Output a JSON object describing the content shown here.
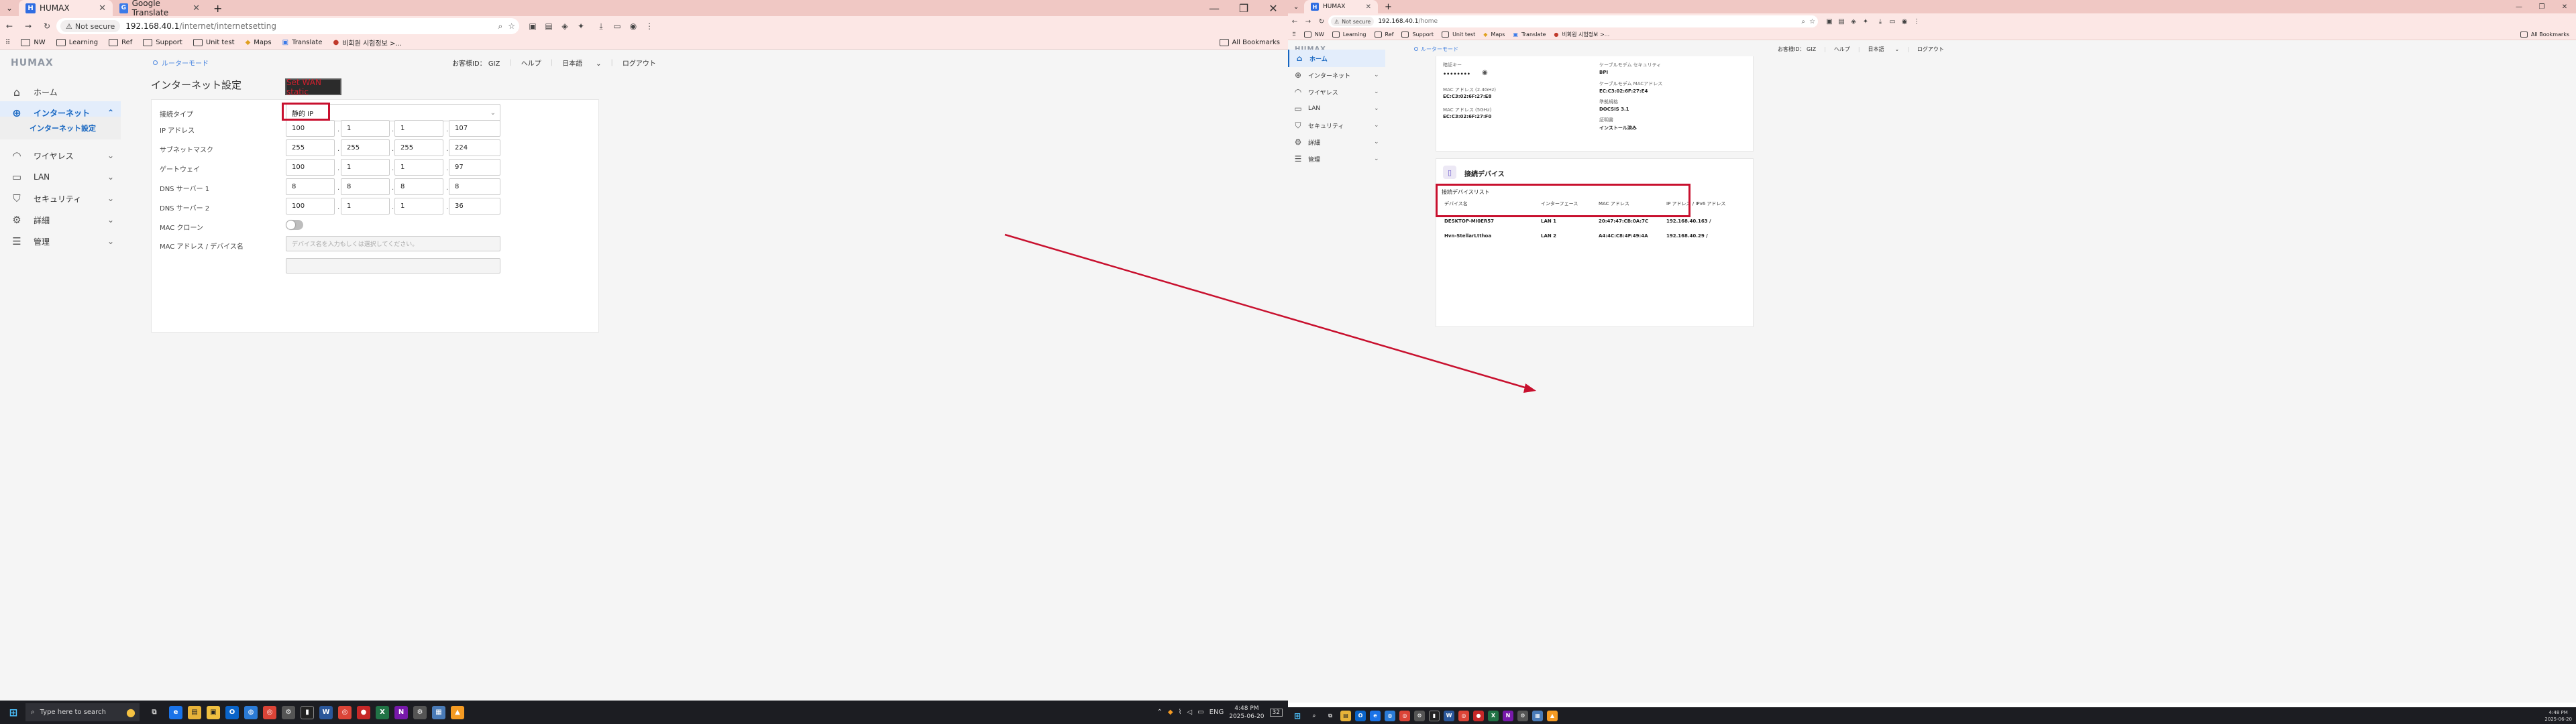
{
  "left": {
    "tabs": [
      {
        "title": "HUMAX"
      },
      {
        "title": "Google Translate"
      }
    ],
    "address": {
      "not_secure": "Not secure",
      "host": "192.168.40.1",
      "path": "/internet/internetsetting"
    },
    "bookmarks": [
      "NW",
      "Learning",
      "Ref",
      "Support",
      "Unit test",
      "Maps",
      "Translate",
      "비회원 시험정보 >..."
    ],
    "all_bookmarks": "All Bookmarks",
    "logo": "HUMAX",
    "router_mode": "ルーターモード",
    "customer_id": "お客様ID： GIZ",
    "help": "ヘルプ",
    "language": "日本語",
    "logout": "ログアウト",
    "nav": [
      {
        "label": "ホーム"
      },
      {
        "label": "インターネット"
      },
      {
        "label": "ワイヤレス"
      },
      {
        "label": "LAN"
      },
      {
        "label": "セキュリティ"
      },
      {
        "label": "詳細"
      },
      {
        "label": "管理"
      }
    ],
    "nav_sub": "インターネット設定",
    "page_title": "インターネット設定",
    "annotation_button": "Set WAN static",
    "form": {
      "connection_type_label": "接続タイプ",
      "connection_type_value": "静的 IP",
      "ip_label": "IP アドレス",
      "ip": [
        "100",
        "1",
        "1",
        "107"
      ],
      "subnet_label": "サブネットマスク",
      "subnet": [
        "255",
        "255",
        "255",
        "224"
      ],
      "gateway_label": "ゲートウェイ",
      "gateway": [
        "100",
        "1",
        "1",
        "97"
      ],
      "dns1_label": "DNS サーバー 1",
      "dns1": [
        "8",
        "8",
        "8",
        "8"
      ],
      "dns2_label": "DNS サーバー 2",
      "dns2": [
        "100",
        "1",
        "1",
        "36"
      ],
      "mac_clone_label": "MAC クローン",
      "mac_addr_label": "MAC アドレス / デバイス名",
      "mac_addr_placeholder": "デバイス名を入力もしくは選択してください。"
    },
    "taskbar": {
      "search_placeholder": "Type here to search",
      "time": "4:48 PM",
      "date": "2025-06-20",
      "lang": "ENG",
      "notif": "32"
    }
  },
  "right": {
    "tabs": [
      {
        "title": "HUMAX"
      }
    ],
    "address": {
      "not_secure": "Not secure",
      "host": "192.168.40.1",
      "path": "/home"
    },
    "bookmarks": [
      "NW",
      "Learning",
      "Ref",
      "Support",
      "Unit test",
      "Maps",
      "Translate",
      "비회원 시험정보 >..."
    ],
    "all_bookmarks": "All Bookmarks",
    "logo": "HUMAX",
    "router_mode": "ルーターモード",
    "customer_id": "お客様ID： GIZ",
    "help": "ヘルプ",
    "language": "日本語",
    "logout": "ログアウト",
    "nav": [
      {
        "label": "ホーム"
      },
      {
        "label": "インターネット"
      },
      {
        "label": "ワイヤレス"
      },
      {
        "label": "LAN"
      },
      {
        "label": "セキュリティ"
      },
      {
        "label": "詳細"
      },
      {
        "label": "管理"
      }
    ],
    "info_left": [
      {
        "label": "暗証キー",
        "value": "••••••••"
      },
      {
        "label": "MAC アドレス (2.4GHz)",
        "value": "EC:C3:02:6F:27:E8"
      },
      {
        "label": "MAC アドレス (5GHz)",
        "value": "EC:C3:02:6F:27:F0"
      }
    ],
    "info_right": [
      {
        "label": "ケーブルモデム セキュリティ",
        "value": "BPI"
      },
      {
        "label": "ケーブルモデム MACアドレス",
        "value": "EC:C3:02:6F:27:E4"
      },
      {
        "label": "準拠規格",
        "value": "DOCSIS 3.1"
      },
      {
        "label": "証明書",
        "value": "インストール済み"
      }
    ],
    "devices_title": "接続デバイス",
    "devices_list_title": "接続デバイスリスト",
    "devices_headers": [
      "デバイス名",
      "インターフェース",
      "MAC アドレス",
      "IP アドレス / IPv6 アドレス"
    ],
    "devices": [
      [
        "DESKTOP-MI0ER57",
        "LAN 1",
        "20:47:47:CB:0A:7C",
        "192.168.40.163 /"
      ],
      [
        "Hvn-StellarLtthoa",
        "LAN 2",
        "A4:4C:C8:4F:49:4A",
        "192.168.40.29 /"
      ]
    ],
    "taskbar": {
      "time": "4:48 PM",
      "date": "2025-06-20"
    }
  }
}
